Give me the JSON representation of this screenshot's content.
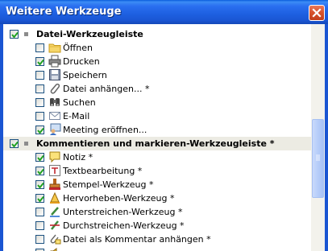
{
  "window": {
    "title": "Weitere Werkzeuge"
  },
  "groups": [
    {
      "label": "Datei-Werkzeugleiste",
      "checked": true,
      "items": [
        {
          "label": "Öffnen",
          "checked": false,
          "icon": "folder-icon"
        },
        {
          "label": "Drucken",
          "checked": true,
          "icon": "printer-icon"
        },
        {
          "label": "Speichern",
          "checked": false,
          "icon": "floppy-disk-icon"
        },
        {
          "label": "Datei anhängen... *",
          "checked": false,
          "icon": "paperclip-icon"
        },
        {
          "label": "Suchen",
          "checked": false,
          "icon": "binoculars-icon"
        },
        {
          "label": "E-Mail",
          "checked": false,
          "icon": "envelope-icon"
        },
        {
          "label": "Meeting eröffnen...",
          "checked": true,
          "icon": "meeting-icon"
        }
      ]
    },
    {
      "label": "Kommentieren und markieren-Werkzeugleiste *",
      "checked": true,
      "items": [
        {
          "label": "Notiz *",
          "checked": true,
          "icon": "note-icon"
        },
        {
          "label": "Textbearbeitung *",
          "checked": true,
          "icon": "text-edit-icon"
        },
        {
          "label": "Stempel-Werkzeug *",
          "checked": true,
          "icon": "stamp-icon"
        },
        {
          "label": "Hervorheben-Werkzeug *",
          "checked": true,
          "icon": "highlight-icon"
        },
        {
          "label": "Unterstreichen-Werkzeug *",
          "checked": false,
          "icon": "underline-icon"
        },
        {
          "label": "Durchstreichen-Werkzeug *",
          "checked": false,
          "icon": "strikethrough-icon"
        },
        {
          "label": "Datei als Kommentar anhängen *",
          "checked": false,
          "icon": "attach-comment-icon"
        }
      ]
    }
  ]
}
